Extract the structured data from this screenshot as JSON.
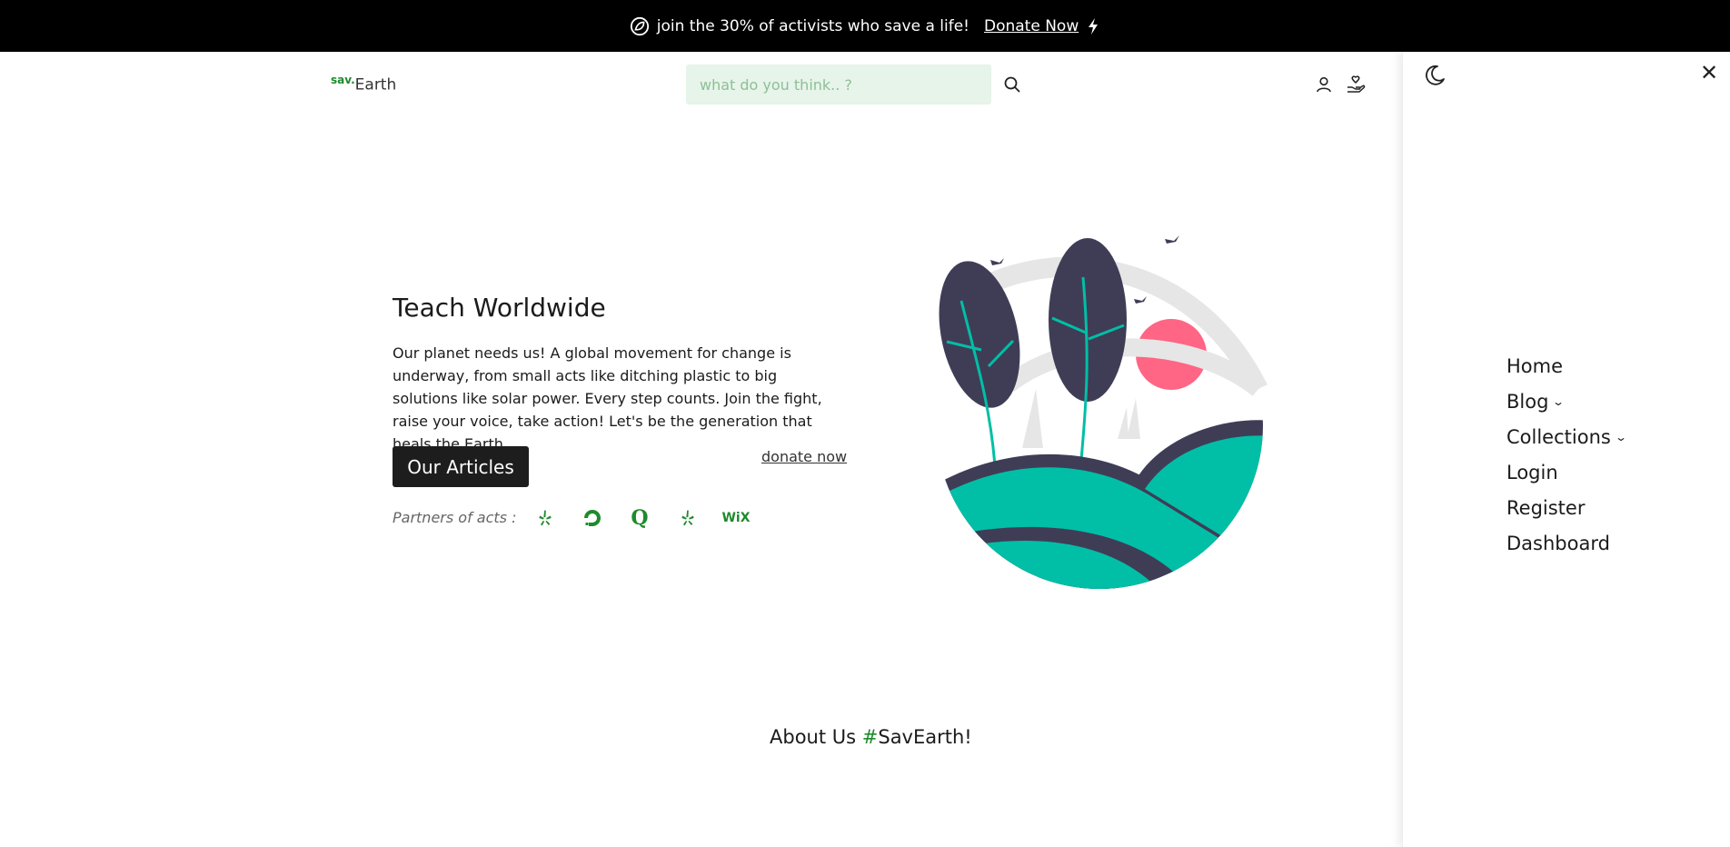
{
  "announcement": {
    "text": "join the 30% of activists who save a life!",
    "link_label": "Donate Now"
  },
  "header": {
    "logo_sup": "sav.",
    "logo_main": "Earth",
    "search_placeholder": "what do you think.. ?"
  },
  "hero": {
    "title": "Teach Worldwide",
    "paragraph": "Our planet needs us! A global movement for change is underway, from small acts like ditching plastic to big solutions like solar power. Every step counts. Join the fight, raise your voice, take action! Let's be the generation that heals the Earth.",
    "primary_button": "Our Articles",
    "secondary_link": "donate now",
    "partners_label": "Partners of acts :",
    "partners": [
      "yelp-icon",
      "digitalocean-icon",
      "quora-icon",
      "yelp-icon",
      "wix-icon"
    ],
    "partner_wix_text": "WiX",
    "partner_q_text": "Q"
  },
  "about": {
    "prefix": "About Us ",
    "hash": "#",
    "suffix": "SavEarth!"
  },
  "side_panel": {
    "close_symbol": "✕",
    "nav": [
      {
        "label": "Home",
        "has_dropdown": false
      },
      {
        "label": "Blog",
        "has_dropdown": true
      },
      {
        "label": "Collections",
        "has_dropdown": true
      },
      {
        "label": "Login",
        "has_dropdown": false
      },
      {
        "label": "Register",
        "has_dropdown": false
      },
      {
        "label": "Dashboard",
        "has_dropdown": false
      }
    ]
  },
  "colors": {
    "brand_green": "#1f8a2c",
    "teal": "#00bfa6",
    "navy": "#3f3d56",
    "pink": "#ff6584",
    "search_bg": "#e6f4ea"
  }
}
